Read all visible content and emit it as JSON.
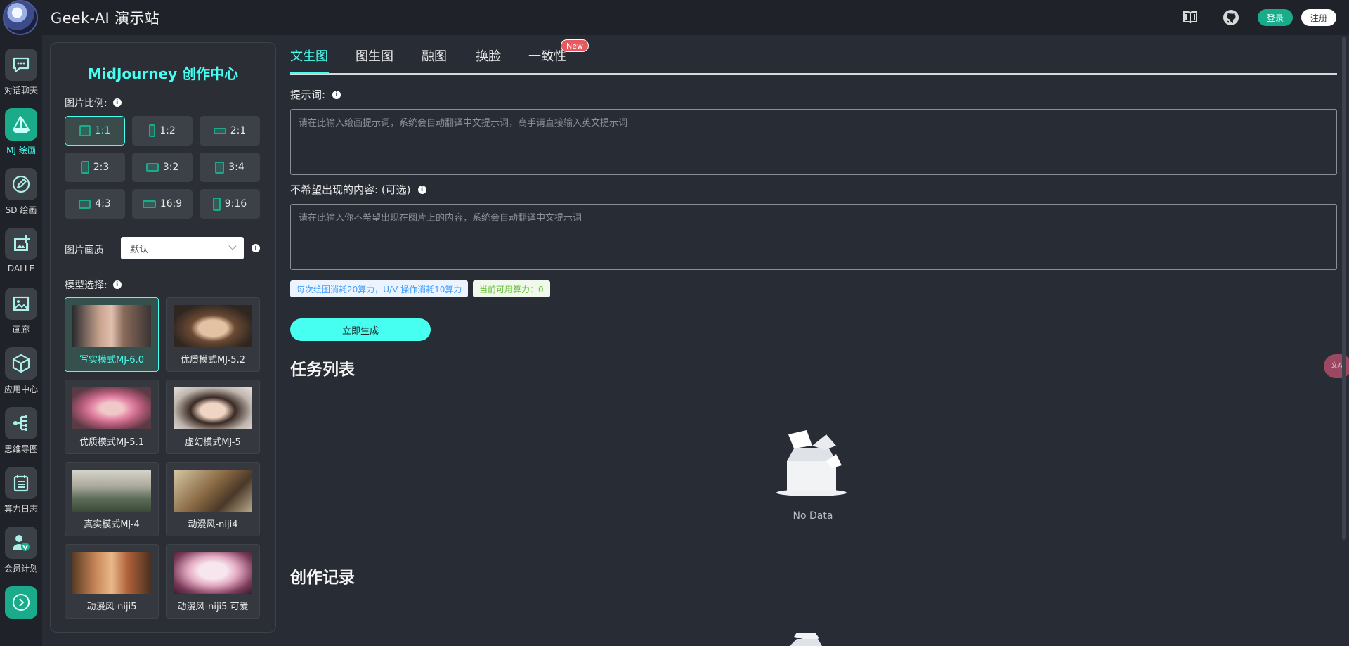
{
  "header": {
    "title": "Geek-AI 演示站",
    "login_label": "登录",
    "register_label": "注册",
    "icons": [
      "book-icon",
      "github-icon"
    ]
  },
  "sidebar": {
    "items": [
      {
        "label": "对话聊天",
        "icon": "chat-icon",
        "active": false
      },
      {
        "label": "MJ 绘画",
        "icon": "sailboat-icon",
        "active": true
      },
      {
        "label": "SD 绘画",
        "icon": "brush-icon",
        "active": false
      },
      {
        "label": "DALLE",
        "icon": "image-plus-icon",
        "active": false
      },
      {
        "label": "画廊",
        "icon": "picture-icon",
        "active": false
      },
      {
        "label": "应用中心",
        "icon": "cube-icon",
        "active": false
      },
      {
        "label": "思维导图",
        "icon": "mindmap-icon",
        "active": false
      },
      {
        "label": "算力日志",
        "icon": "list-icon",
        "active": false
      },
      {
        "label": "会员计划",
        "icon": "vip-user-icon",
        "active": false
      }
    ],
    "expand_icon": "chevron-right-icon"
  },
  "config": {
    "title": "MidJourney 创作中心",
    "ratio_label": "图片比例:",
    "ratios": [
      {
        "label": "1:1",
        "active": true
      },
      {
        "label": "1:2",
        "active": false
      },
      {
        "label": "2:1",
        "active": false
      },
      {
        "label": "2:3",
        "active": false
      },
      {
        "label": "3:2",
        "active": false
      },
      {
        "label": "3:4",
        "active": false
      },
      {
        "label": "4:3",
        "active": false
      },
      {
        "label": "16:9",
        "active": false
      },
      {
        "label": "9:16",
        "active": false
      }
    ],
    "quality_label": "图片画质",
    "quality_value": "默认",
    "model_label": "模型选择:",
    "models": [
      {
        "name": "写实模式MJ-6.0",
        "active": true
      },
      {
        "name": "优质模式MJ-5.2",
        "active": false
      },
      {
        "name": "优质模式MJ-5.1",
        "active": false
      },
      {
        "name": "虚幻模式MJ-5",
        "active": false
      },
      {
        "name": "真实模式MJ-4",
        "active": false
      },
      {
        "name": "动漫风-niji4",
        "active": false
      },
      {
        "name": "动漫风-niji5",
        "active": false
      },
      {
        "name": "动漫风-niji5 可爱",
        "active": false
      }
    ]
  },
  "main": {
    "tabs": [
      {
        "label": "文生图",
        "active": true
      },
      {
        "label": "图生图",
        "active": false
      },
      {
        "label": "融图",
        "active": false
      },
      {
        "label": "换脸",
        "active": false
      },
      {
        "label": "一致性",
        "active": false
      }
    ],
    "new_badge": "New",
    "prompt_label": "提示词:",
    "prompt_placeholder": "请在此输入绘画提示词，系统会自动翻译中文提示词，高手请直接输入英文提示词",
    "negative_label": "不希望出现的内容:  (可选)",
    "negative_placeholder": "请在此输入你不希望出现在图片上的内容，系统会自动翻译中文提示词",
    "cost_tag": "每次绘图消耗20算力，U/V 操作消耗10算力",
    "power_tag": "当前可用算力：0",
    "generate_label": "立即生成",
    "task_title": "任务列表",
    "empty_text": "No Data",
    "record_title": "创作记录"
  },
  "colors": {
    "accent": "#47fff1",
    "brand_green": "#1aab8a",
    "background": "#282c34",
    "badge_red": "#e8595d"
  }
}
